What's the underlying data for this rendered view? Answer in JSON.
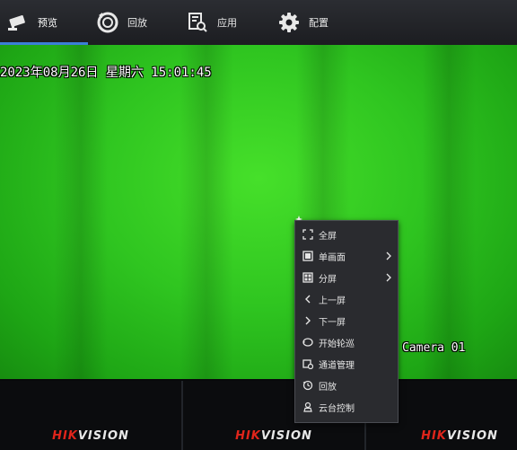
{
  "nav": {
    "items": [
      {
        "label": "预览",
        "icon": "camera-icon"
      },
      {
        "label": "回放",
        "icon": "playback-icon"
      },
      {
        "label": "应用",
        "icon": "app-search-icon"
      },
      {
        "label": "配置",
        "icon": "gear-icon"
      }
    ],
    "active_index": 0
  },
  "video": {
    "datetime": "2023年08月26日 星期六 15:01:45",
    "camera_label": "Camera 01"
  },
  "context_menu": {
    "items": [
      {
        "label": "全屏",
        "icon": "fullscreen-icon",
        "submenu": false
      },
      {
        "label": "单画面",
        "icon": "single-view-icon",
        "submenu": true
      },
      {
        "label": "分屏",
        "icon": "split-view-icon",
        "submenu": true
      },
      {
        "label": "上一屏",
        "icon": "chevron-left-icon",
        "submenu": false
      },
      {
        "label": "下一屏",
        "icon": "chevron-right-icon",
        "submenu": false
      },
      {
        "label": "开始轮巡",
        "icon": "cycle-icon",
        "submenu": false
      },
      {
        "label": "通道管理",
        "icon": "channel-manage-icon",
        "submenu": false
      },
      {
        "label": "回放",
        "icon": "playback-icon",
        "submenu": false
      },
      {
        "label": "云台控制",
        "icon": "ptz-icon",
        "submenu": false
      }
    ]
  },
  "tiles": {
    "brand_hik": "HIK",
    "brand_vision": "VISION"
  },
  "colors": {
    "accent": "#3b7fd6",
    "video_green": "#2fc520",
    "brand_red": "#e0251b"
  }
}
